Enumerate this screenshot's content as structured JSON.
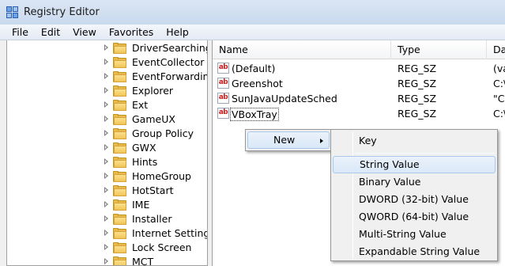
{
  "window": {
    "title": "Registry Editor"
  },
  "menubar": [
    "File",
    "Edit",
    "View",
    "Favorites",
    "Help"
  ],
  "tree": {
    "items": [
      "DriverSearching",
      "EventCollector",
      "EventForwarding",
      "Explorer",
      "Ext",
      "GameUX",
      "Group Policy",
      "GWX",
      "Hints",
      "HomeGroup",
      "HotStart",
      "IME",
      "Installer",
      "Internet Settings",
      "Lock Screen",
      "MCT"
    ]
  },
  "list": {
    "columns": [
      "Name",
      "Type",
      "Data"
    ],
    "rows": [
      {
        "name": "(Default)",
        "type": "REG_SZ",
        "data": "(va"
      },
      {
        "name": "Greenshot",
        "type": "REG_SZ",
        "data": "C:\\"
      },
      {
        "name": "SunJavaUpdateSched",
        "type": "REG_SZ",
        "data": "\"C:"
      },
      {
        "name": "VBoxTray",
        "type": "REG_SZ",
        "data": "C:\\"
      }
    ],
    "icon_text": "ab"
  },
  "context_menu": {
    "new_label": "New"
  },
  "submenu": {
    "key": "Key",
    "items": [
      "String Value",
      "Binary Value",
      "DWORD (32-bit) Value",
      "QWORD (64-bit) Value",
      "Multi-String Value",
      "Expandable String Value"
    ]
  },
  "colors": {
    "highlight_border": "#a8c8ec",
    "folder": "#f1c558",
    "icon_red": "#cc1f1f"
  }
}
